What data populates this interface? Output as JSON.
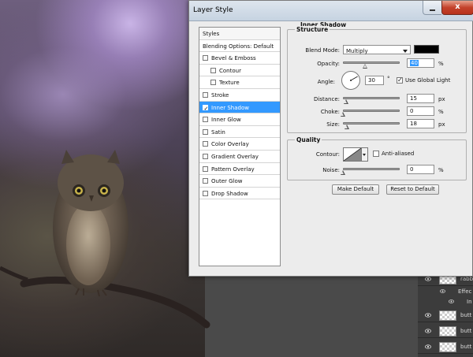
{
  "dialog": {
    "title": "Layer Style",
    "close_glyph": "x"
  },
  "styles_list": {
    "header": "Styles",
    "items": [
      {
        "label": "Blending Options: Default",
        "checkbox": false,
        "checked": false,
        "indent": 0
      },
      {
        "label": "Bevel & Emboss",
        "checkbox": true,
        "checked": false,
        "indent": 0
      },
      {
        "label": "Contour",
        "checkbox": true,
        "checked": false,
        "indent": 1
      },
      {
        "label": "Texture",
        "checkbox": true,
        "checked": false,
        "indent": 1
      },
      {
        "label": "Stroke",
        "checkbox": true,
        "checked": false,
        "indent": 0
      },
      {
        "label": "Inner Shadow",
        "checkbox": true,
        "checked": true,
        "indent": 0,
        "selected": true
      },
      {
        "label": "Inner Glow",
        "checkbox": true,
        "checked": false,
        "indent": 0
      },
      {
        "label": "Satin",
        "checkbox": true,
        "checked": false,
        "indent": 0
      },
      {
        "label": "Color Overlay",
        "checkbox": true,
        "checked": false,
        "indent": 0
      },
      {
        "label": "Gradient Overlay",
        "checkbox": true,
        "checked": false,
        "indent": 0
      },
      {
        "label": "Pattern Overlay",
        "checkbox": true,
        "checked": false,
        "indent": 0
      },
      {
        "label": "Outer Glow",
        "checkbox": true,
        "checked": false,
        "indent": 0
      },
      {
        "label": "Drop Shadow",
        "checkbox": true,
        "checked": false,
        "indent": 0
      }
    ]
  },
  "inner_shadow": {
    "section_title": "Inner Shadow",
    "structure": {
      "title": "Structure",
      "blend_mode_label": "Blend Mode:",
      "blend_mode_value": "Multiply",
      "shadow_color": "#000000",
      "opacity_label": "Opacity:",
      "opacity_value": "40",
      "opacity_unit": "%",
      "opacity_fraction": 0.4,
      "angle_label": "Angle:",
      "angle_value": "30",
      "angle_unit": "°",
      "angle_degrees": 30,
      "use_global_light_label": "Use Global Light",
      "use_global_light_checked": true,
      "distance_label": "Distance:",
      "distance_value": "15",
      "distance_unit": "px",
      "distance_fraction": 0.06,
      "choke_label": "Choke:",
      "choke_value": "0",
      "choke_unit": "%",
      "choke_fraction": 0.0,
      "size_label": "Size:",
      "size_value": "18",
      "size_unit": "px",
      "size_fraction": 0.07
    },
    "quality": {
      "title": "Quality",
      "contour_label": "Contour:",
      "anti_aliased_label": "Anti-aliased",
      "anti_aliased_checked": false,
      "noise_label": "Noise:",
      "noise_value": "0",
      "noise_unit": "%",
      "noise_fraction": 0.0
    },
    "make_default_label": "Make Default",
    "reset_default_label": "Reset to Default"
  },
  "layers_panel": {
    "rows": [
      {
        "label": "rabb"
      },
      {
        "label": "butt"
      },
      {
        "label": "butt"
      },
      {
        "label": "butt"
      }
    ],
    "effects_label": "Effec",
    "effect_item_label": "In"
  }
}
